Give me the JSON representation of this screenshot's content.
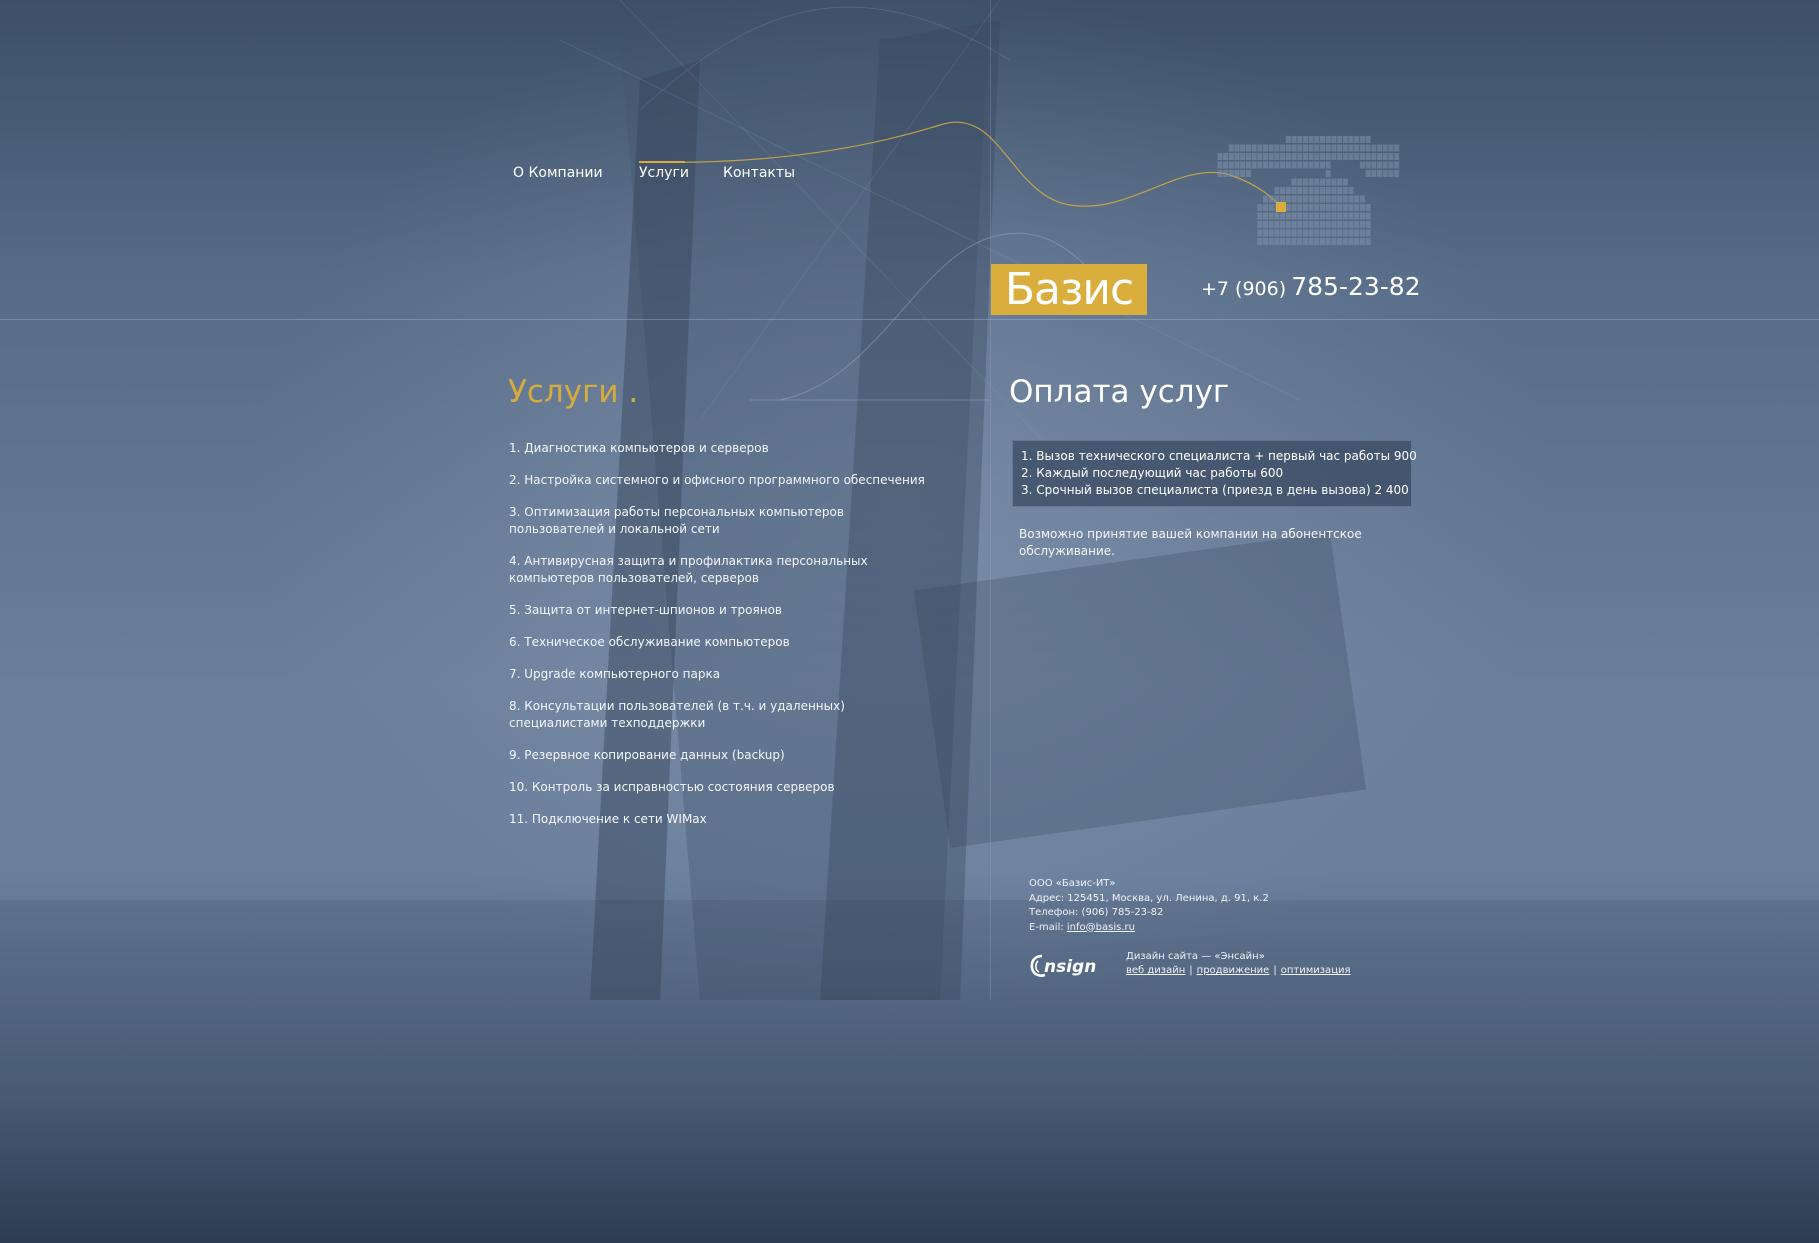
{
  "nav": {
    "items": [
      {
        "label": "О Компании"
      },
      {
        "label": "Услуги"
      },
      {
        "label": "Контакты"
      }
    ],
    "active_index": 1
  },
  "brand": {
    "logo_text": "Базис",
    "phone_code": "+7 (906)",
    "phone_number": "785-23-82"
  },
  "services": {
    "title": "Услуги .",
    "items": [
      "1. Диагностика компьютеров и серверов",
      "2. Настройка системного и офисного программного обеспечения",
      "3. Оптимизация работы персональных компьютеров пользователей и локальной сети",
      "4. Антивирусная защита и профилактика персональных компьютеров пользователей, серверов",
      "5. Защита от интернет-шпионов и троянов",
      "6. Техническое обслуживание компьютеров",
      "7. Upgrade компьютерного парка",
      "8. Консультации пользователей (в т.ч. и удаленных) специалистами техподдержки",
      "9. Резервное копирование данных (backup)",
      "10. Контроль за исправностью состояния серверов",
      "11. Подключение к сети WIMax"
    ]
  },
  "payment": {
    "title": "Оплата услуг",
    "prices": [
      "1. Вызов технического специалиста + первый час работы 900",
      "2. Каждый последующий час работы 600",
      "3. Срочный вызов специалиста (приезд в день вызова) 2 400"
    ],
    "note": "Возможно принятие вашей компании на абонентское обслуживание."
  },
  "footer": {
    "company": "ООО «Базис-ИТ»",
    "address": "Адрес: 125451, Москва, ул. Ленина, д. 91, к.2",
    "phone": "Телефон: (906) 785-23-82",
    "email_label": "E-mail: ",
    "email": "info@basis.ru"
  },
  "designer": {
    "logo_text": "nsign",
    "credit": "Дизайн сайта — «Энсайн»",
    "links": [
      "веб дизайн",
      "продвижение",
      "оптимизация"
    ]
  },
  "colors": {
    "accent": "#d9ae3d",
    "background_top": "#3c4f67",
    "background_mid": "#6b7f9c",
    "background_bottom": "#2d3d52"
  },
  "icons": {
    "phone": "retro-telephone-icon"
  }
}
